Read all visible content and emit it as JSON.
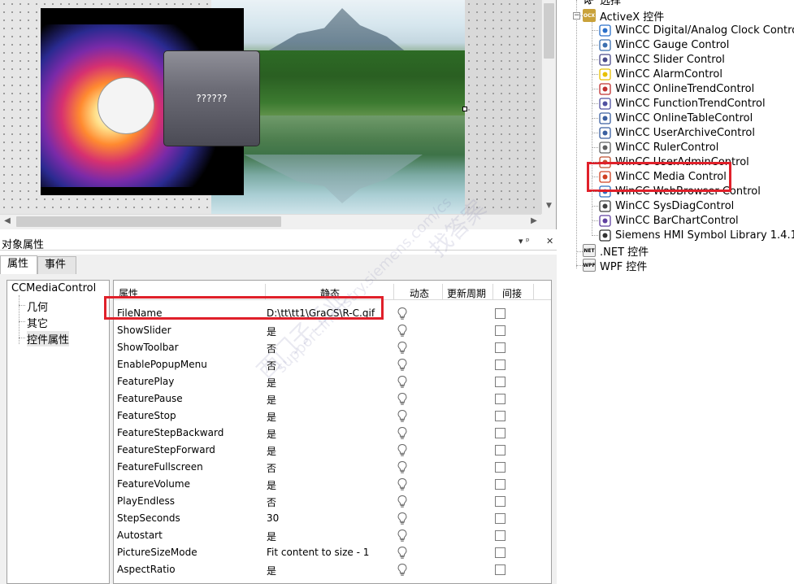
{
  "canvas": {
    "popup_text": "??????"
  },
  "tree": {
    "top_item": "选择",
    "activex_label": "ActiveX 控件",
    "controls": [
      {
        "label": "WinCC Digital/Analog Clock Control",
        "icon": "clock-icon",
        "color": "#2a6fc9"
      },
      {
        "label": "WinCC Gauge Control",
        "icon": "gauge-icon",
        "color": "#3a6fb0"
      },
      {
        "label": "WinCC Slider Control",
        "icon": "slider-icon",
        "color": "#4a4a8a"
      },
      {
        "label": "WinCC AlarmControl",
        "icon": "warning-icon",
        "color": "#e8c000"
      },
      {
        "label": "WinCC OnlineTrendControl",
        "icon": "trend-icon",
        "color": "#c03030"
      },
      {
        "label": "WinCC FunctionTrendControl",
        "icon": "function-trend-icon",
        "color": "#5050a0"
      },
      {
        "label": "WinCC OnlineTableControl",
        "icon": "table-icon",
        "color": "#3a5fa0"
      },
      {
        "label": "WinCC UserArchiveControl",
        "icon": "archive-icon",
        "color": "#3a5fa0"
      },
      {
        "label": "WinCC RulerControl",
        "icon": "ruler-icon",
        "color": "#606060"
      },
      {
        "label": "WinCC UserAdminControl",
        "icon": "user-admin-icon",
        "color": "#c05030"
      },
      {
        "label": "WinCC Media Control",
        "icon": "media-icon",
        "color": "#d04020"
      },
      {
        "label": "WinCC WebBrowser Control",
        "icon": "globe-icon",
        "color": "#3070c0"
      },
      {
        "label": "WinCC SysDiagControl",
        "icon": "sysdiag-icon",
        "color": "#404040"
      },
      {
        "label": "WinCC BarChartControl",
        "icon": "bar-chart-icon",
        "color": "#6040a0"
      },
      {
        "label": "Siemens HMI Symbol Library 1.4.1",
        "icon": "symbol-library-icon",
        "color": "#303030"
      }
    ],
    "net_label": ".NET 控件",
    "wpf_label": "WPF 控件",
    "net_icon_text": "NET",
    "wpf_icon_text": "WPF",
    "ocx_icon_text": "OCX"
  },
  "props": {
    "panel_title": "对象属性",
    "pin_glyph": "▾ ᵖ",
    "close_glyph": "✕",
    "tabs": [
      "属性",
      "事件"
    ],
    "object_name": "CCMediaControl",
    "categories": [
      "几何",
      "其它",
      "控件属性"
    ],
    "headers": {
      "property": "属性",
      "static": "静态",
      "dynamic": "动态",
      "update_cycle": "更新周期",
      "indirect": "间接"
    },
    "rows": [
      {
        "name": "FileName",
        "value": "D:\\tt\\tt1\\GraCS\\R-C.gif"
      },
      {
        "name": "ShowSlider",
        "value": "是"
      },
      {
        "name": "ShowToolbar",
        "value": "否"
      },
      {
        "name": "EnablePopupMenu",
        "value": "否"
      },
      {
        "name": "FeaturePlay",
        "value": "是"
      },
      {
        "name": "FeaturePause",
        "value": "是"
      },
      {
        "name": "FeatureStop",
        "value": "是"
      },
      {
        "name": "FeatureStepBackward",
        "value": "是"
      },
      {
        "name": "FeatureStepForward",
        "value": "是"
      },
      {
        "name": "FeatureFullscreen",
        "value": "否"
      },
      {
        "name": "FeatureVolume",
        "value": "是"
      },
      {
        "name": "PlayEndless",
        "value": "否"
      },
      {
        "name": "StepSeconds",
        "value": "30"
      },
      {
        "name": "Autostart",
        "value": "是"
      },
      {
        "name": "PictureSizeMode",
        "value": "Fit content to size - 1"
      },
      {
        "name": "AspectRatio",
        "value": "是"
      }
    ]
  },
  "watermark": {
    "text1": "西门子工业",
    "text2": "support.industry.siemens.com/cs",
    "text3": "找答案"
  },
  "colors": {
    "highlight": "#e0202a",
    "panel_bg": "#f0f0f0"
  }
}
